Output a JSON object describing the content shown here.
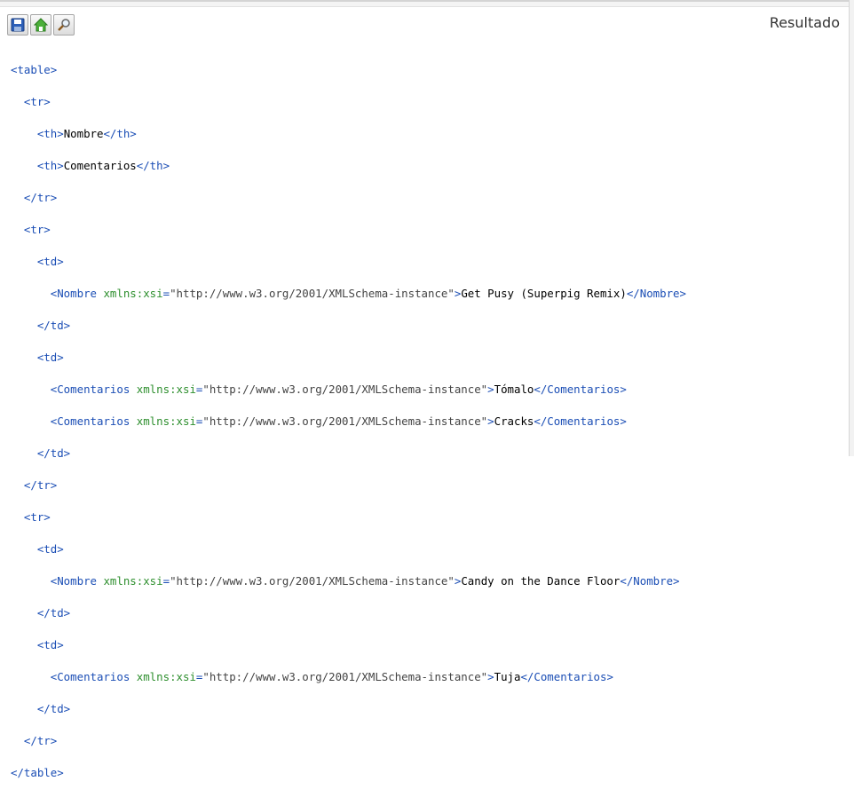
{
  "header": {
    "title": "Resultado"
  },
  "toolbar": [
    {
      "icon": "save-icon"
    },
    {
      "icon": "home-icon"
    },
    {
      "icon": "search-icon"
    }
  ],
  "xml": {
    "table_open": "<table>",
    "table_close": "</table>",
    "tr_open": "<tr>",
    "tr_close": "</tr>",
    "td_open": "<td>",
    "td_close": "</td>",
    "th_open": "<th>",
    "th_close": "</th>",
    "header_cells": [
      "Nombre",
      "Comentarios"
    ],
    "attr_name": "xmlns:xsi",
    "attr_eq": "=",
    "attr_value": "\"http://www.w3.org/2001/XMLSchema-instance\"",
    "row1": {
      "nombre_open": "<Nombre",
      "nombre_value": "Get Pusy (Superpig Remix)",
      "nombre_close": "</Nombre>",
      "comentarios_open": "<Comentarios",
      "comentarios_close": "</Comentarios>",
      "comentarios": [
        "Tómalo",
        "Cracks"
      ]
    },
    "row2": {
      "nombre_open": "<Nombre",
      "nombre_value": "Candy on the Dance Floor",
      "nombre_close": "</Nombre>",
      "comentarios_open": "<Comentarios",
      "comentarios_close": "</Comentarios>",
      "comentarios": [
        "Tuja"
      ]
    },
    "gt": ">"
  }
}
